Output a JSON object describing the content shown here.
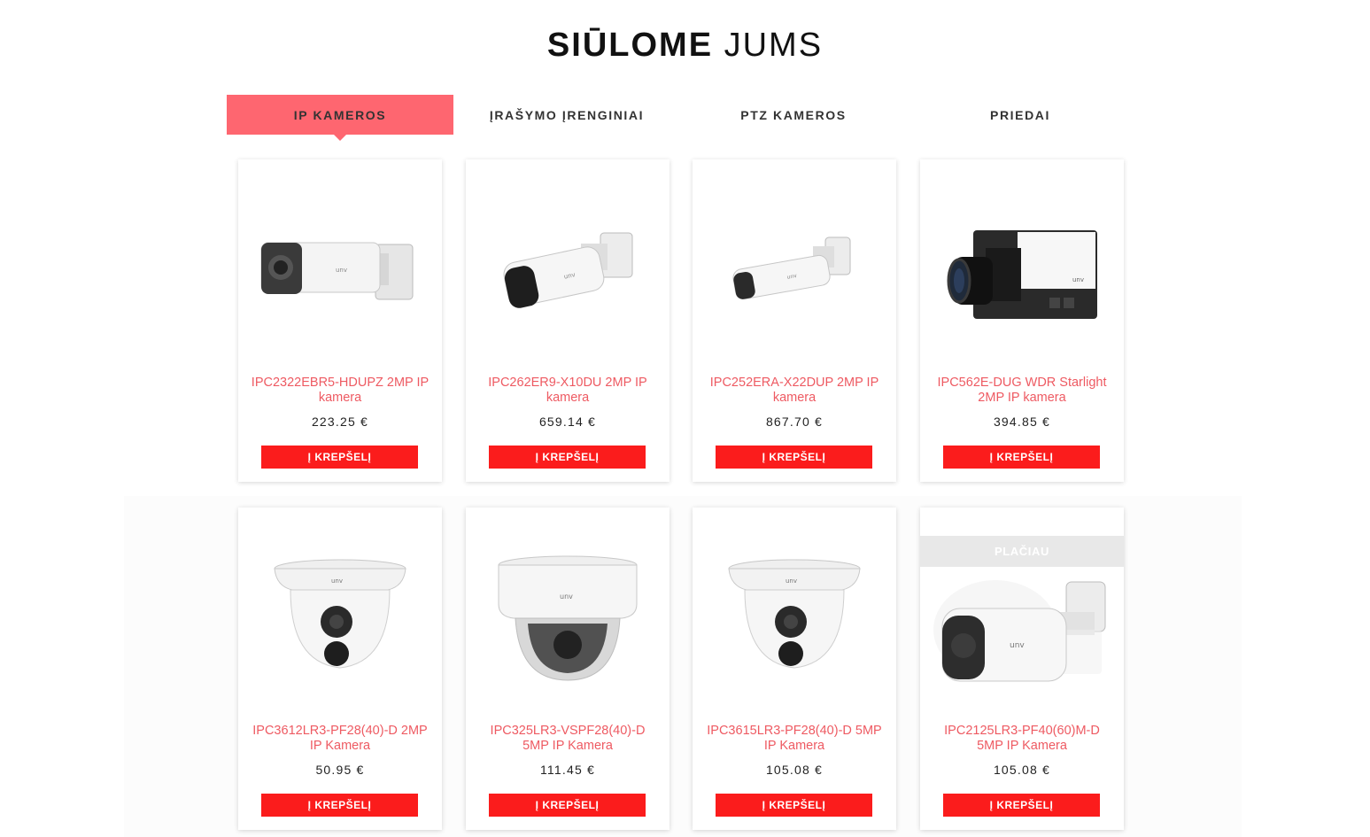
{
  "section": {
    "title_bold": "SIŪLOME",
    "title_light": "JUMS"
  },
  "tabs": [
    {
      "label": "IP KAMEROS",
      "active": true
    },
    {
      "label": "ĮRAŠYMO ĮRENGINIAI",
      "active": false
    },
    {
      "label": "PTZ KAMEROS",
      "active": false
    },
    {
      "label": "PRIEDAI",
      "active": false
    }
  ],
  "products": [
    {
      "name": "IPC2322EBR5-HDUPZ 2MP IP kamera",
      "price": "223.25 €",
      "cart_label": "Į KREPŠELĮ",
      "image": "bullet-camera-icon"
    },
    {
      "name": "IPC262ER9-X10DU 2MP IP kamera",
      "price": "659.14 €",
      "cart_label": "Į KREPŠELĮ",
      "image": "bullet-camera-icon"
    },
    {
      "name": "IPC252ERA-X22DUP 2MP IP kamera",
      "price": "867.70 €",
      "cart_label": "Į KREPŠELĮ",
      "image": "bullet-camera-icon"
    },
    {
      "name": "IPC562E-DUG WDR Starlight 2MP IP kamera",
      "price": "394.85 €",
      "cart_label": "Į KREPŠELĮ",
      "image": "box-camera-icon"
    },
    {
      "name": "IPC3612LR3-PF28(40)-D 2MP IP Kamera",
      "price": "50.95 €",
      "cart_label": "Į KREPŠELĮ",
      "image": "turret-camera-icon"
    },
    {
      "name": "IPC325LR3-VSPF28(40)-D 5MP IP Kamera",
      "price": "111.45 €",
      "cart_label": "Į KREPŠELĮ",
      "image": "dome-camera-icon"
    },
    {
      "name": "IPC3615LR3-PF28(40)-D 5MP IP Kamera",
      "price": "105.08 €",
      "cart_label": "Į KREPŠELĮ",
      "image": "turret-camera-icon"
    },
    {
      "name": "IPC2125LR3-PF40(60)M-D 5MP IP Kamera",
      "price": "105.08 €",
      "cart_label": "Į KREPŠELĮ",
      "image": "mini-bullet-camera-icon",
      "hover_label": "PLAČIAU"
    }
  ],
  "colors": {
    "accent": "#fe6670",
    "cart": "#fb1c1c",
    "product_name": "#ee5a62"
  }
}
